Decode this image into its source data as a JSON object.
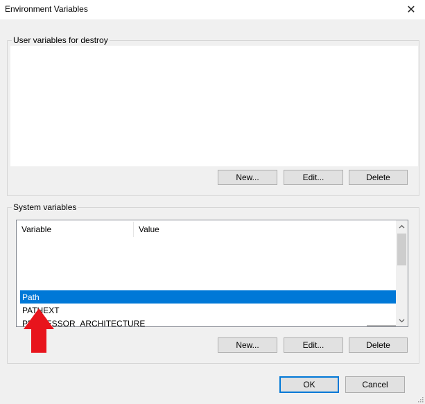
{
  "window": {
    "title": "Environment Variables",
    "close_glyph": "✕"
  },
  "user_group": {
    "label": "User variables for destroy",
    "buttons": {
      "new": "New...",
      "edit": "Edit...",
      "delete": "Delete"
    }
  },
  "system_group": {
    "label": "System variables",
    "columns": {
      "variable": "Variable",
      "value": "Value"
    },
    "rows": [
      {
        "variable": "Path",
        "selected": true
      },
      {
        "variable": "PATHEXT",
        "selected": false
      },
      {
        "variable": "PROCESSOR_ARCHITECTURE",
        "selected": false
      }
    ],
    "buttons": {
      "new": "New...",
      "edit": "Edit...",
      "delete": "Delete"
    }
  },
  "footer": {
    "ok": "OK",
    "cancel": "Cancel"
  },
  "icons": {
    "close": "close-icon",
    "scroll_up": "chevron-up-icon",
    "scroll_down": "chevron-down-icon",
    "annotation": "red-arrow-up-icon",
    "resize": "resize-grip-icon"
  },
  "colors": {
    "selection": "#0078d7",
    "annotation_arrow": "#e8141c",
    "dialog_bg": "#f0f0f0"
  }
}
